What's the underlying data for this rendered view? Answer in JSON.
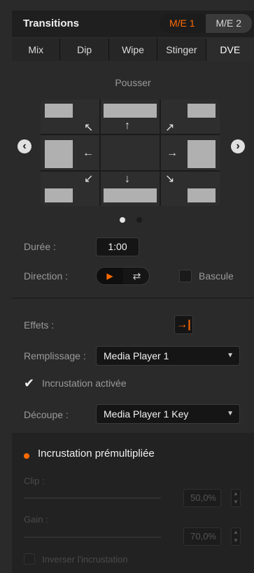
{
  "header": {
    "title": "Transitions",
    "me_tabs": [
      "M/E 1",
      "M/E 2"
    ],
    "active_me": "M/E 1"
  },
  "tabs": [
    {
      "label": "Mix"
    },
    {
      "label": "Dip"
    },
    {
      "label": "Wipe"
    },
    {
      "label": "Stinger"
    },
    {
      "label": "DVE"
    }
  ],
  "active_tab": "DVE",
  "dve": {
    "effect_name": "Pousser",
    "page_indicator": {
      "total": 2,
      "active": 1
    }
  },
  "controls": {
    "duration_label": "Durée :",
    "duration_value": "1:00",
    "direction_label": "Direction :",
    "flip_label": "Bascule",
    "effects_label": "Effets :",
    "fill_label": "Remplissage :",
    "fill_value": "Media Player 1",
    "keyer_enabled_label": "Incrustation activée",
    "keyer_enabled": true,
    "cut_label": "Découpe :",
    "cut_value": "Media Player 1 Key"
  },
  "premultiplied": {
    "label": "Incrustation prémultipliée",
    "clip_label": "Clip :",
    "clip_value": "50,0%",
    "gain_label": "Gain :",
    "gain_value": "70,0%",
    "invert_label": "Inverser l'incrustation"
  },
  "colors": {
    "accent": "#ff6a00",
    "panel_bg": "#2a2a2a"
  }
}
